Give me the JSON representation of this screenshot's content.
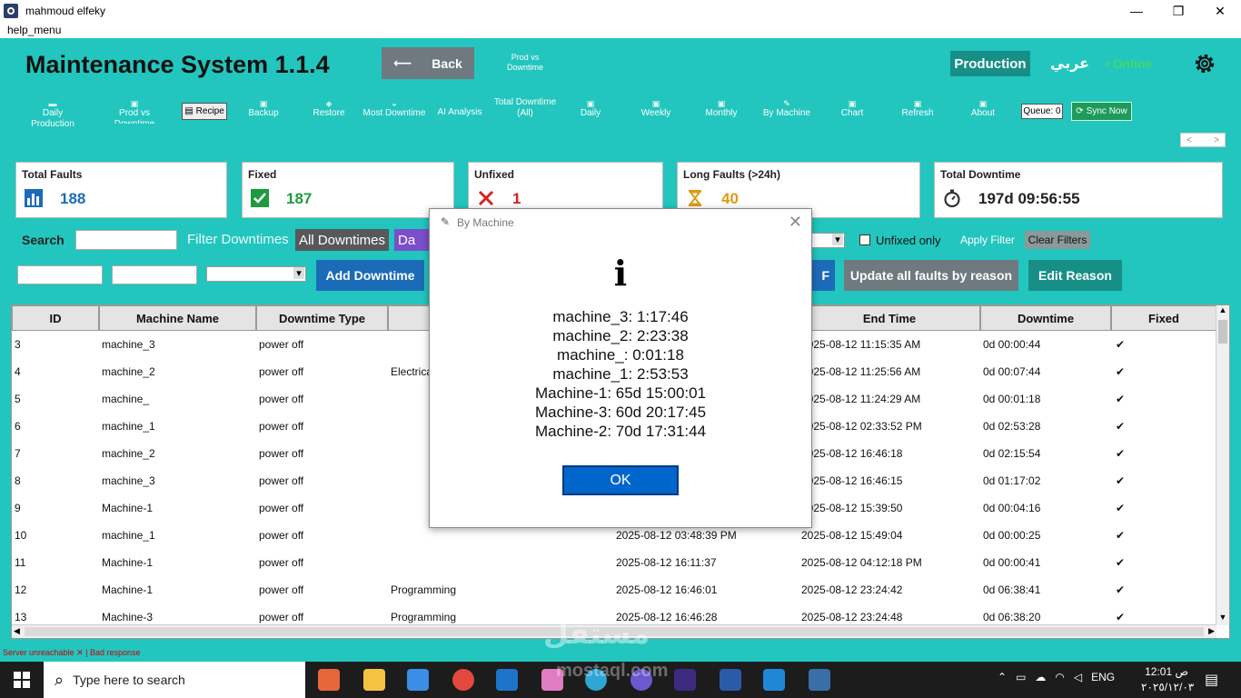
{
  "window": {
    "title": "mahmoud elfeky",
    "minimize": "—",
    "maximize": "❐",
    "close": "✕"
  },
  "menu": {
    "help": "help_menu"
  },
  "header": {
    "app_title": "Maintenance System 1.1.4",
    "back_arrow": "⟵",
    "back_label": "Back",
    "prod_vs_downtime": "Prod vs Downtime",
    "production": "Production",
    "arabic": "عربي",
    "online": "• Online"
  },
  "toolbar": {
    "daily_production": "Daily Production",
    "prod_vs_downtime": "Prod vs Downtime",
    "recipe": "Recipe",
    "backup": "Backup",
    "restore": "Restore",
    "most_downtime": "Most Downtime",
    "ai_analysis": "AI Analysis",
    "total_downtime_all": "Total Downtime (All)",
    "daily": "Daily",
    "weekly": "Weekly",
    "monthly": "Monthly",
    "by_machine": "By Machine",
    "chart": "Chart",
    "refresh": "Refresh",
    "about": "About",
    "queue": "Queue: 0",
    "sync_now": "Sync Now",
    "pager_prev": "<",
    "pager_next": ">"
  },
  "cards": {
    "total_faults": {
      "label": "Total Faults",
      "value": "188",
      "color": "#1c6bb8"
    },
    "fixed": {
      "label": "Fixed",
      "value": "187",
      "color": "#1e9b3c"
    },
    "unfixed": {
      "label": "Unfixed",
      "value": "1",
      "color": "#d62020"
    },
    "long_faults": {
      "label": "Long Faults (>24h)",
      "value": "40",
      "color": "#e09a10"
    },
    "total_downtime": {
      "label": "Total Downtime",
      "value": "197d 09:56:55",
      "color": "#222222"
    }
  },
  "filters": {
    "search_label": "Search",
    "filter_downtimes": "Filter Downtimes",
    "all_downtimes": "All Downtimes",
    "daily_pill": "Da",
    "unfixed_only": "Unfixed only",
    "apply_filter": "Apply Filter",
    "clear_filters": "Clear Filters"
  },
  "actions": {
    "add_downtime": "Add Downtime",
    "pdf_tail": "F",
    "update_all": "Update all faults by reason",
    "edit_reason": "Edit Reason"
  },
  "table": {
    "headers": [
      "ID",
      "Machine Name",
      "Downtime Type",
      "",
      "",
      "End Time",
      "Downtime",
      "Fixed"
    ],
    "rows": [
      [
        "3",
        "machine_3",
        "power off",
        "",
        "",
        "2025-08-12 11:15:35 AM",
        "0d 00:00:44",
        "✔"
      ],
      [
        "4",
        "machine_2",
        "power off",
        "Electrica",
        "",
        "2025-08-12 11:25:56 AM",
        "0d 00:07:44",
        "✔"
      ],
      [
        "5",
        "machine_",
        "power off",
        "",
        "",
        "2025-08-12 11:24:29 AM",
        "0d 00:01:18",
        "✔"
      ],
      [
        "6",
        "machine_1",
        "power off",
        "",
        "",
        "2025-08-12 02:33:52 PM",
        "0d 02:53:28",
        "✔"
      ],
      [
        "7",
        "machine_2",
        "power off",
        "",
        "",
        "2025-08-12 16:46:18",
        "0d 02:15:54",
        "✔"
      ],
      [
        "8",
        "machine_3",
        "power off",
        "",
        "",
        "2025-08-12 16:46:15",
        "0d 01:17:02",
        "✔"
      ],
      [
        "9",
        "Machine-1",
        "power off",
        "",
        "",
        "2025-08-12 15:39:50",
        "0d 00:04:16",
        "✔"
      ],
      [
        "10",
        "machine_1",
        "power off",
        "",
        "2025-08-12 03:48:39 PM",
        "2025-08-12 15:49:04",
        "0d 00:00:25",
        "✔"
      ],
      [
        "11",
        "Machine-1",
        "power off",
        "",
        "2025-08-12 16:11:37",
        "2025-08-12 04:12:18 PM",
        "0d 00:00:41",
        "✔"
      ],
      [
        "12",
        "Machine-1",
        "power off",
        "Programming",
        "2025-08-12 16:46:01",
        "2025-08-12 23:24:42",
        "0d 06:38:41",
        "✔"
      ],
      [
        "13",
        "Machine-3",
        "power off",
        "Programming",
        "2025-08-12 16:46:28",
        "2025-08-12 23:24:48",
        "0d 06:38:20",
        "✔"
      ]
    ]
  },
  "status": {
    "server": "Server unreachable",
    "separator": "|",
    "bad_response": "Bad response"
  },
  "dialog": {
    "title": "By Machine",
    "icon": "i",
    "lines": [
      "machine_3: 1:17:46",
      "machine_2: 2:23:38",
      "machine_: 0:01:18",
      "machine_1: 2:53:53",
      "Machine-1: 65d 15:00:01",
      "Machine-3: 60d 20:17:45",
      "Machine-2: 70d 17:31:44"
    ],
    "ok": "OK"
  },
  "taskbar": {
    "search_placeholder": "Type here to search",
    "lang": "ENG",
    "time": "12:01 ص",
    "date": "٢٠٢٥/١٢/٠٣",
    "watermark": "مستقل",
    "watermark_sub": "mostaql.com"
  },
  "icons": {
    "app": "app-icon",
    "settings": "gear-icon",
    "feather": "feather-icon",
    "bar_chart": "bar-chart-icon",
    "check": "check-icon",
    "cross": "cross-icon",
    "hourglass": "hourglass-icon",
    "stopwatch": "stopwatch-icon"
  }
}
